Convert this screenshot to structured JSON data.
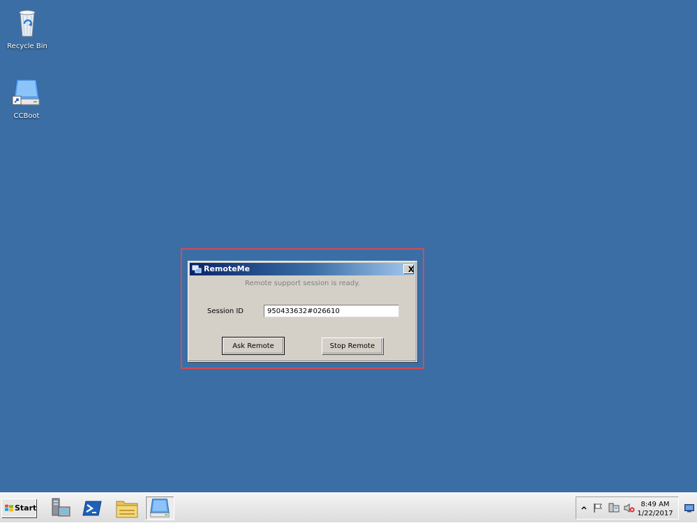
{
  "desktop": {
    "background_color": "#3a6ea5",
    "icons": [
      {
        "label": "Recycle Bin",
        "icon": "recycle-bin-icon"
      },
      {
        "label": "CCBoot",
        "icon": "ccboot-drive-icon"
      }
    ]
  },
  "dialog": {
    "title": "RemoteMe",
    "close_label": "X",
    "status": "Remote support session is ready.",
    "session_label": "Session ID",
    "session_value": "950433632#026610",
    "ask_button": "Ask Remote",
    "stop_button": "Stop Remote"
  },
  "taskbar": {
    "start_label": "Start",
    "pinned": [
      {
        "icon": "server-manager-icon"
      },
      {
        "icon": "powershell-icon"
      },
      {
        "icon": "file-explorer-icon"
      },
      {
        "icon": "ccboot-drive-icon",
        "active": true
      }
    ],
    "tray_icons": [
      "show-hidden-icons-chevron-icon",
      "action-center-flag-icon",
      "network-icon",
      "volume-muted-icon"
    ],
    "clock": {
      "time": "8:49 AM",
      "date": "1/22/2017"
    }
  },
  "colors": {
    "highlight_border": "#e0474c",
    "dialog_face": "#d4d0c8",
    "title_gradient_start": "#0a246a"
  }
}
